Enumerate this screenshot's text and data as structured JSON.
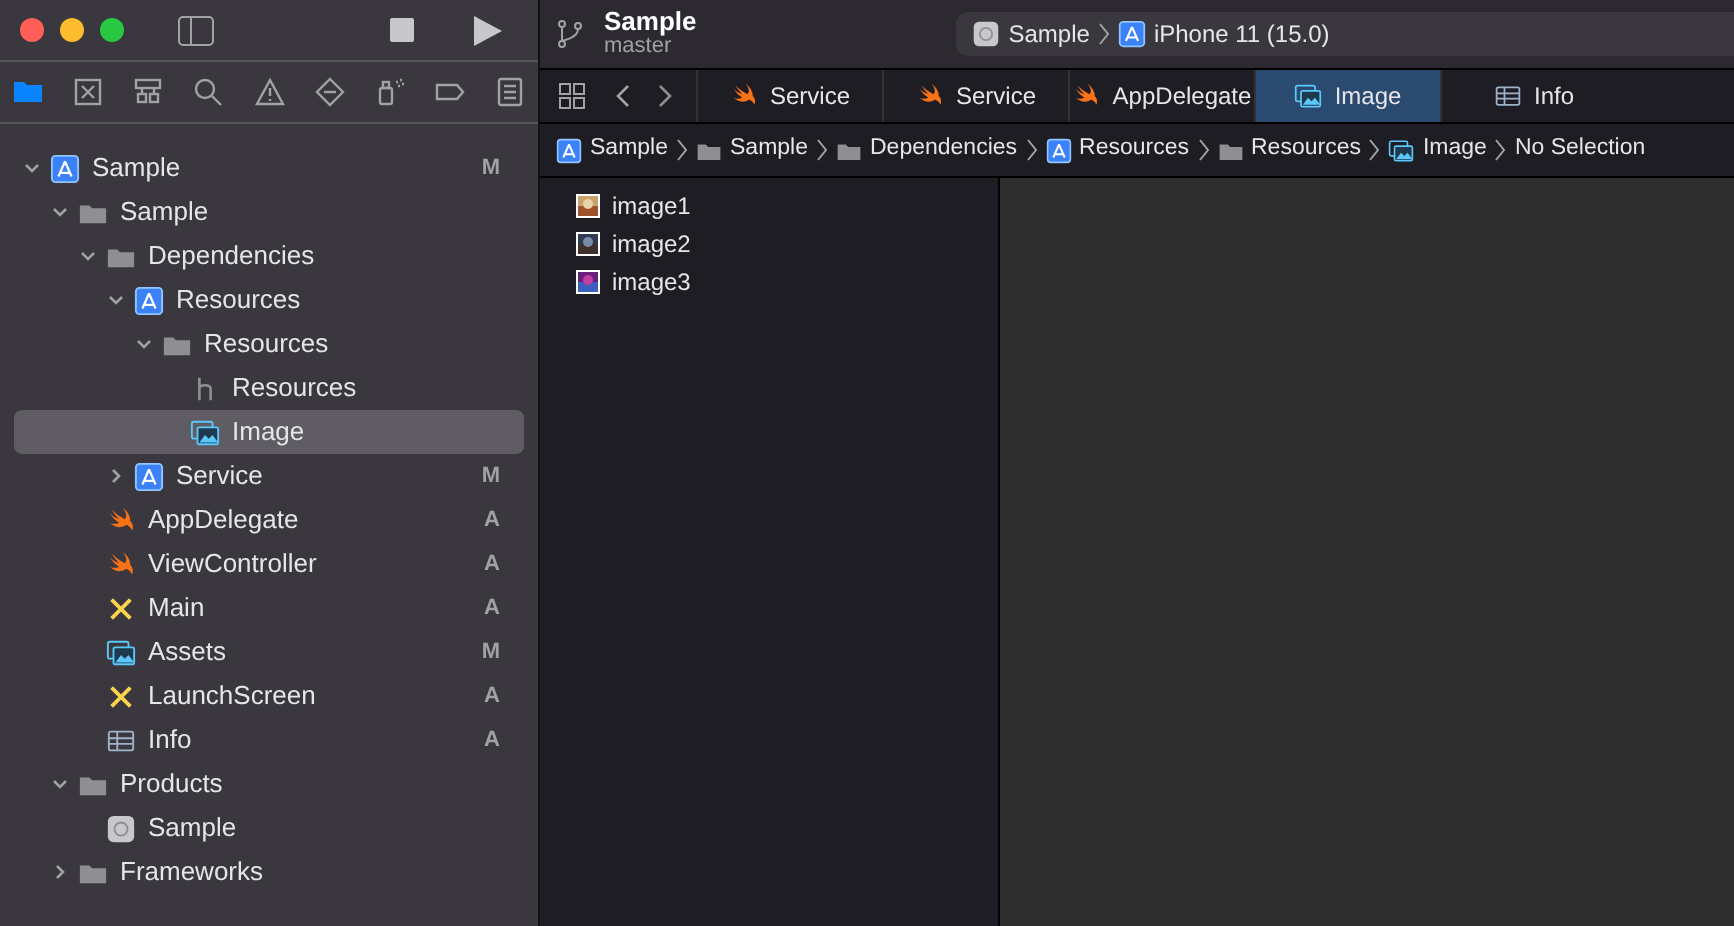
{
  "toolbar": {
    "project": "Sample",
    "branch": "master",
    "scheme": {
      "target": "Sample",
      "device": "iPhone 11 (15.0)"
    }
  },
  "navigator_tabs": [
    {
      "kind": "folder",
      "selected": true
    },
    {
      "kind": "source",
      "selected": false
    },
    {
      "kind": "hierarchy",
      "selected": false
    },
    {
      "kind": "search",
      "selected": false
    },
    {
      "kind": "warning",
      "selected": false
    },
    {
      "kind": "test",
      "selected": false
    },
    {
      "kind": "debug",
      "selected": false
    },
    {
      "kind": "breakpoint",
      "selected": false
    },
    {
      "kind": "report",
      "selected": false
    }
  ],
  "tree": [
    {
      "name": "Sample",
      "kind": "project",
      "badge": "M",
      "expanded": true,
      "selected": false,
      "children": [
        {
          "name": "Sample",
          "kind": "folder",
          "expanded": true,
          "selected": false,
          "children": [
            {
              "name": "Dependencies",
              "kind": "folder",
              "expanded": true,
              "selected": false,
              "children": [
                {
                  "name": "Resources",
                  "kind": "project",
                  "expanded": true,
                  "selected": false,
                  "children": [
                    {
                      "name": "Resources",
                      "kind": "folder",
                      "expanded": true,
                      "selected": false,
                      "children": [
                        {
                          "name": "Resources",
                          "kind": "header",
                          "selected": false
                        },
                        {
                          "name": "Image",
                          "kind": "assets",
                          "selected": true
                        }
                      ]
                    }
                  ]
                },
                {
                  "name": "Service",
                  "kind": "project",
                  "badge": "M",
                  "expanded": false,
                  "selected": false
                }
              ]
            },
            {
              "name": "AppDelegate",
              "kind": "swift",
              "badge": "A",
              "selected": false
            },
            {
              "name": "ViewController",
              "kind": "swift",
              "badge": "A",
              "selected": false
            },
            {
              "name": "Main",
              "kind": "storyboard",
              "badge": "A",
              "selected": false
            },
            {
              "name": "Assets",
              "kind": "assets",
              "badge": "M",
              "selected": false
            },
            {
              "name": "LaunchScreen",
              "kind": "storyboard",
              "badge": "A",
              "selected": false
            },
            {
              "name": "Info",
              "kind": "plist",
              "badge": "A",
              "selected": false
            }
          ]
        },
        {
          "name": "Products",
          "kind": "folder",
          "expanded": true,
          "selected": false,
          "children": [
            {
              "name": "Sample",
              "kind": "app",
              "selected": false
            }
          ]
        },
        {
          "name": "Frameworks",
          "kind": "folder",
          "expanded": false,
          "selected": false
        }
      ]
    }
  ],
  "editor_tabs": [
    {
      "label": "Service",
      "kind": "swift",
      "selected": false
    },
    {
      "label": "Service",
      "kind": "swift",
      "selected": false
    },
    {
      "label": "AppDelegate",
      "kind": "swift",
      "selected": false
    },
    {
      "label": "Image",
      "kind": "assets",
      "selected": true
    },
    {
      "label": "Info",
      "kind": "plist",
      "selected": false
    }
  ],
  "breadcrumb": [
    {
      "label": "Sample",
      "kind": "project"
    },
    {
      "label": "Sample",
      "kind": "folder"
    },
    {
      "label": "Dependencies",
      "kind": "folder"
    },
    {
      "label": "Resources",
      "kind": "project"
    },
    {
      "label": "Resources",
      "kind": "folder"
    },
    {
      "label": "Image",
      "kind": "assets"
    },
    {
      "label": "No Selection",
      "kind": "text"
    }
  ],
  "asset_list": [
    {
      "name": "image1",
      "kind": "picture"
    },
    {
      "name": "image2",
      "kind": "picture"
    },
    {
      "name": "image3",
      "kind": "picture"
    }
  ]
}
